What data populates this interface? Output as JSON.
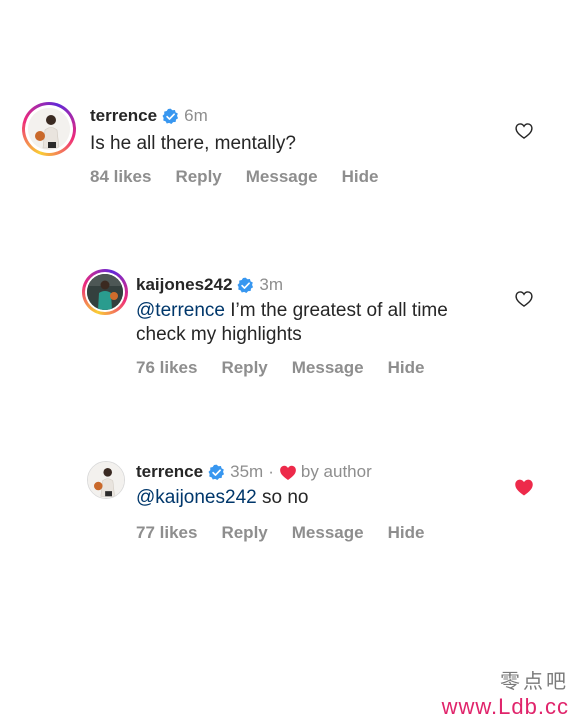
{
  "comments": [
    {
      "username": "terrence",
      "time": "6m",
      "text": "Is he all there, mentally?",
      "actions": {
        "likes": "84 likes",
        "reply": "Reply",
        "message": "Message",
        "hide": "Hide"
      },
      "liked": false
    },
    {
      "username": "kaijones242",
      "time": "3m",
      "mention": "@terrence",
      "text_line1": " I’m the greatest of all time",
      "text_line2": "check my highlights",
      "actions": {
        "likes": "76 likes",
        "reply": "Reply",
        "message": "Message",
        "hide": "Hide"
      },
      "liked": false
    },
    {
      "username": "terrence",
      "time": "35m",
      "separator": "·",
      "author_badge": "by author",
      "mention": "@kaijones242",
      "text": " so no",
      "actions": {
        "likes": "77 likes",
        "reply": "Reply",
        "message": "Message",
        "hide": "Hide"
      },
      "liked": true
    }
  ],
  "watermark": {
    "chinese": "零点吧",
    "url": "www.Ldb.cc"
  },
  "colors": {
    "verified": "#3897f0",
    "liked_heart": "#ed2a4a",
    "mention": "#00376b",
    "muted": "#8e8e8e"
  }
}
